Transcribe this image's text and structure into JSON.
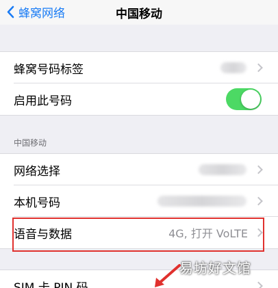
{
  "nav": {
    "back_label": "蜂窝网络",
    "title": "中国移动"
  },
  "group1": {
    "rows": [
      {
        "label": "蜂窝号码标签"
      },
      {
        "label": "启用此号码",
        "toggle_on": true
      }
    ]
  },
  "section2": {
    "header": "中国移动",
    "rows": [
      {
        "label": "网络选择"
      },
      {
        "label": "本机号码"
      },
      {
        "label": "语音与数据",
        "value": "4G, 打开 VoLTE"
      }
    ]
  },
  "group3": {
    "rows": [
      {
        "label": "SIM 卡 PIN 码"
      }
    ]
  },
  "watermark": "易坊好文馆",
  "colors": {
    "accent": "#1a7cf5",
    "toggle_on": "#4cd964",
    "highlight": "#e0302d"
  }
}
